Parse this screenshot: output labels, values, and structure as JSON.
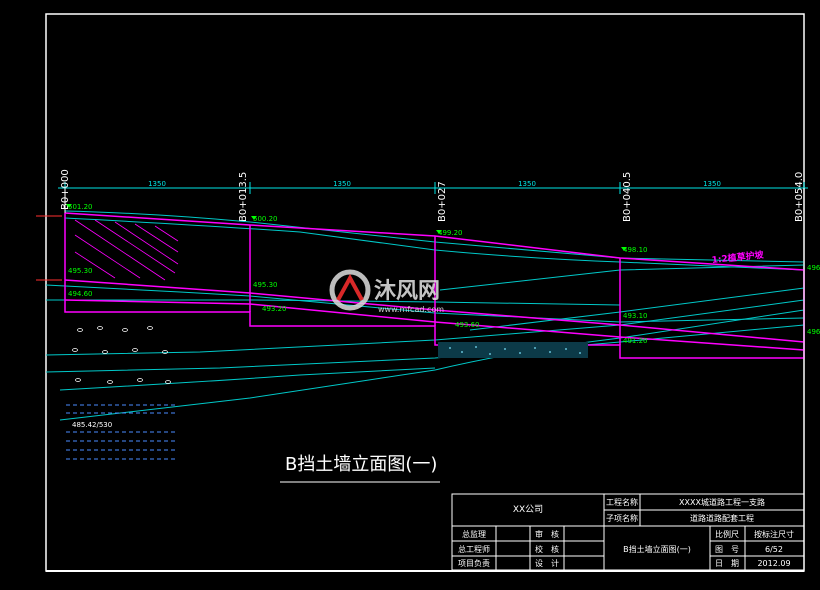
{
  "drawing": {
    "title": "B挡土墙立面图(一)",
    "slope_note": "1:2植草护坡",
    "watermark_cn": "沐风网",
    "watermark_url": "www.mfcad.com",
    "colors": {
      "background": "#000000",
      "frame": "#ffffff",
      "wall": "#ff00ff",
      "ground": "#00c8c8",
      "dimension": "#00e5e5",
      "label": "#00ff00",
      "text": "#ffffff"
    },
    "stations": [
      {
        "label": "B0+000"
      },
      {
        "label": "B0+013.5"
      },
      {
        "label": "B0+027"
      },
      {
        "label": "B0+040.5"
      },
      {
        "label": "B0+054.0"
      }
    ],
    "spacing_labels": [
      "1350",
      "1350",
      "1350",
      "1350"
    ],
    "top_elevations": [
      "501.20",
      "500.20",
      "499.20",
      "498.10",
      "496.2"
    ],
    "base_elevations": [
      "495.30",
      "495.30",
      "493.60",
      "491.20"
    ],
    "other_elevations": [
      "494.60",
      "493.20",
      "493.10",
      "496.9"
    ],
    "note_label": "485.42/530"
  },
  "title_block": {
    "company": "XX公司",
    "project_label": "工程名称",
    "project_value": "XXXX城道路工程一支路",
    "subproject_label": "子项名称",
    "subproject_value": "道路道路配套工程",
    "roles": [
      {
        "left": "总监理",
        "right": "审　核"
      },
      {
        "left": "总工程师",
        "right": "校　核"
      },
      {
        "left": "项目负责",
        "right": "设　计"
      }
    ],
    "drawing_name": "B挡土墙立面图(一)",
    "meta": [
      {
        "label": "比例尺",
        "value": "按标注尺寸"
      },
      {
        "label": "图　号",
        "value": "6/52"
      },
      {
        "label": "日　期",
        "value": "2012.09"
      }
    ]
  }
}
